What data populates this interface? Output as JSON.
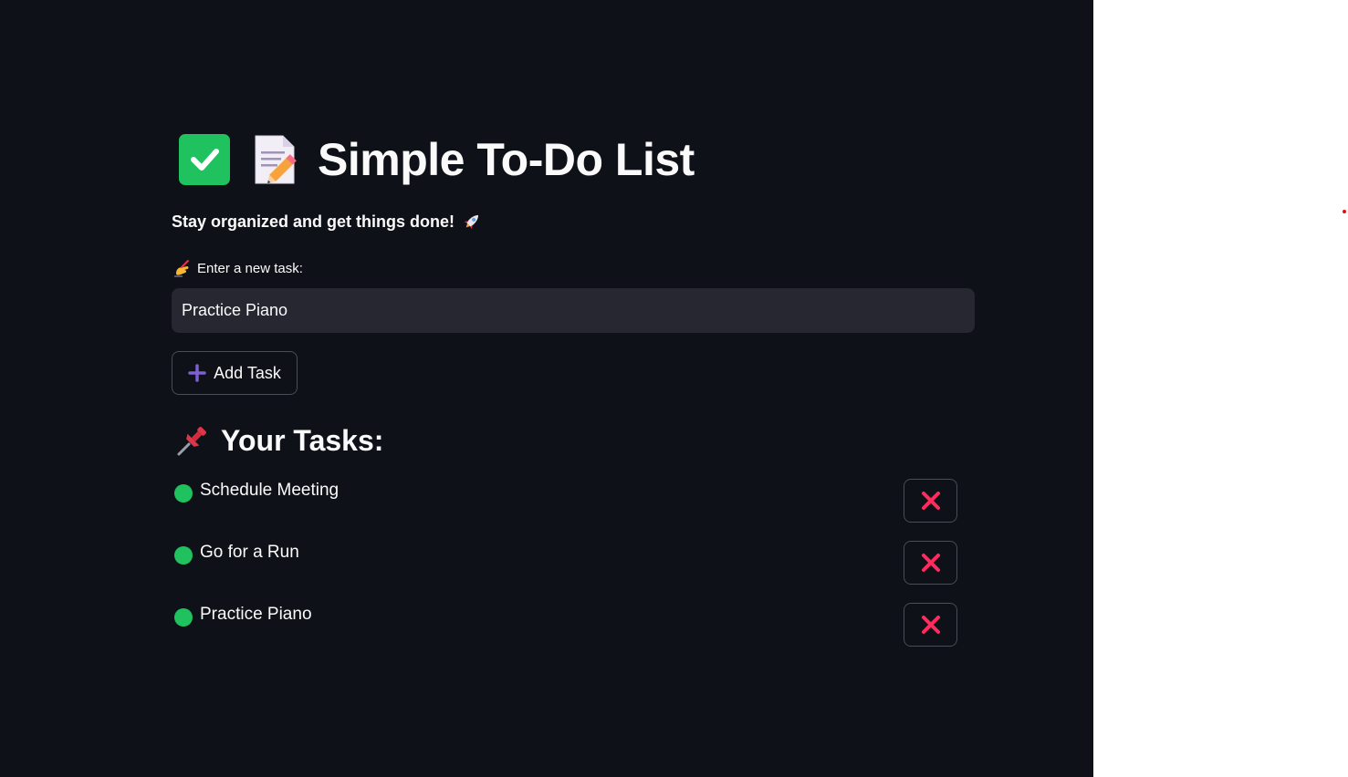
{
  "header": {
    "title": "Simple To-Do List",
    "subtitle": "Stay organized and get things done!",
    "icons": [
      "check-mark-button-icon",
      "memo-icon",
      "rocket-icon"
    ]
  },
  "form": {
    "label": "Enter a new task:",
    "label_icon": "writing-hand-icon",
    "input_value": "Practice Piano",
    "add_button_label": "Add Task",
    "add_button_icon": "plus-icon"
  },
  "tasks_section": {
    "heading": "Your Tasks:",
    "heading_icon": "pushpin-icon",
    "items": [
      {
        "text": "Schedule Meeting"
      },
      {
        "text": "Go for a Run"
      },
      {
        "text": "Practice Piano"
      }
    ]
  },
  "colors": {
    "background": "#0e1117",
    "input_background": "#262730",
    "status_dot": "#1fc25e",
    "delete_x": "#ff2b5e",
    "plus": "#7d5fd1"
  }
}
